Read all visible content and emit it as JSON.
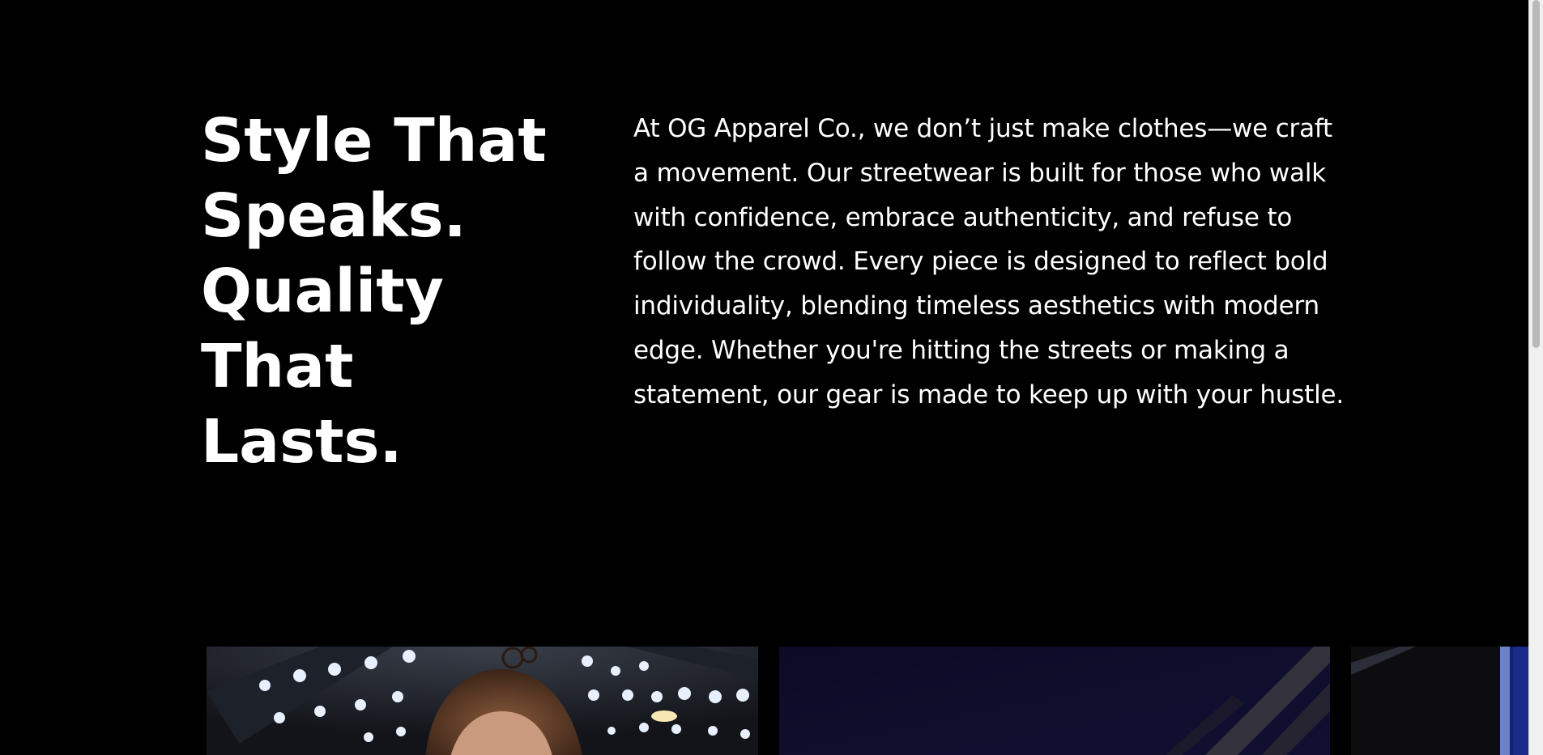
{
  "intro": {
    "headline_lines": [
      "Style That",
      "Speaks.",
      "Quality",
      "That",
      "Lasts."
    ],
    "body": "At OG Apparel Co., we don’t just make clothes—we craft a movement. Our streetwear is built for those who walk with confidence, embrace authenticity, and refuse to follow the crowd. Every piece is designed to reflect bold individuality, blending timeless aesthetics with modern edge. Whether you're hitting the streets or making a statement, our gear is made to keep up with your hustle."
  },
  "gallery": {
    "images": [
      {
        "subject": "model-on-runway-with-stage-lights"
      },
      {
        "subject": "dark-night-street-scene"
      },
      {
        "subject": "blue-lit-partial-image"
      }
    ]
  },
  "colors": {
    "background": "#000000",
    "text": "#ffffff",
    "scrollbar_track": "#f0f0f0",
    "scrollbar_thumb": "#b9b9b9"
  }
}
